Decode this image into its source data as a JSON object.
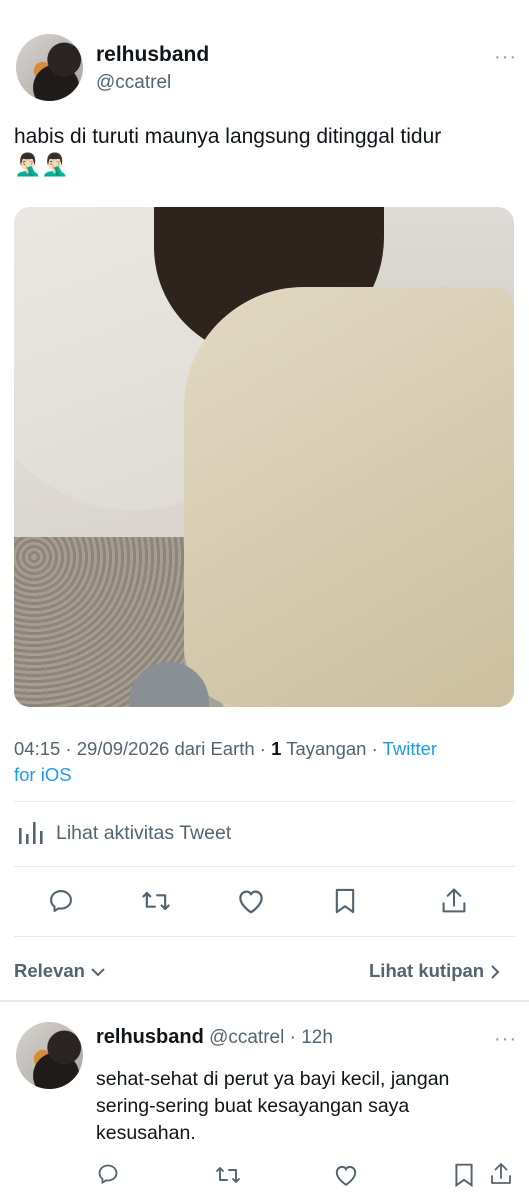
{
  "tweet": {
    "display_name": "relhusband",
    "handle": "@ccatrel",
    "more": "···",
    "text": "habis di turuti maunya langsung ditinggal tidur",
    "emojis": "🤦🏻‍♂️🤦🏻‍♂️",
    "photo_alt": "",
    "meta": {
      "time_date": "04:15 · 29/09/2026 dari Earth ·",
      "views_count": "1",
      "views_label": "Tayangan",
      "separator": "·",
      "source_part1": "Twitter",
      "source_part2": "for iOS"
    },
    "activity_label": "Lihat aktivitas Tweet"
  },
  "actions": {
    "reply": "reply-icon",
    "retweet": "retweet-icon",
    "like": "heart-icon",
    "bookmark": "bookmark-icon",
    "share": "share-icon"
  },
  "replies_header": {
    "sort_label": "Relevan",
    "quotes_label": "Lihat kutipan"
  },
  "reply": {
    "display_name": "relhusband",
    "handle": "@ccatrel",
    "time": "· 12h",
    "more": "···",
    "text_line1": "sehat-sehat di perut ya bayi kecil, jangan",
    "text_line2": "sering-sering buat kesayangan saya",
    "text_line3": "kesusahan."
  },
  "colors": {
    "accent": "#1d9bf0",
    "text": "#0f1419",
    "muted": "#536471",
    "divider": "#e6e9ec"
  }
}
